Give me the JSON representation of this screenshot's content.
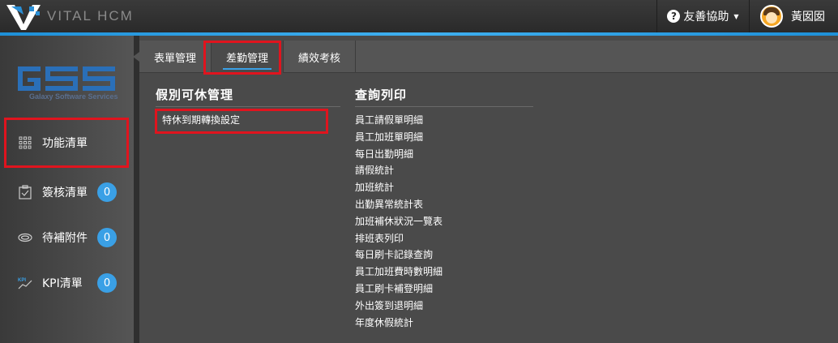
{
  "header": {
    "brand": "VITAL HCM",
    "help_label": "友善協助",
    "user_name": "黃囡囡"
  },
  "sidebar": {
    "logo_sub": "Galaxy Software Services",
    "items": [
      {
        "label": "功能清單",
        "icon": "grid-icon"
      },
      {
        "label": "簽核清單",
        "icon": "clipboard-icon",
        "badge": "0"
      },
      {
        "label": "待補附件",
        "icon": "attachment-icon",
        "badge": "0"
      },
      {
        "label": "KPI清單",
        "icon": "kpi-icon",
        "badge": "0"
      }
    ]
  },
  "tabs": [
    "表單管理",
    "差勤管理",
    "績效考核"
  ],
  "columns": {
    "leave": {
      "title": "假別可休管理",
      "links": [
        "特休到期轉換設定"
      ]
    },
    "query": {
      "title": "查詢列印",
      "links": [
        "員工請假單明細",
        "員工加班單明細",
        "每日出勤明細",
        "請假統計",
        "加班統計",
        "出勤異常統計表",
        "加班補休狀況一覽表",
        "排班表列印",
        "每日刷卡記錄查詢",
        "員工加班費時數明細",
        "員工刷卡補登明細",
        "外出簽到退明細",
        "年度休假統計"
      ]
    }
  },
  "colors": {
    "accent": "#3aa0e6",
    "highlight": "#e0141e"
  }
}
